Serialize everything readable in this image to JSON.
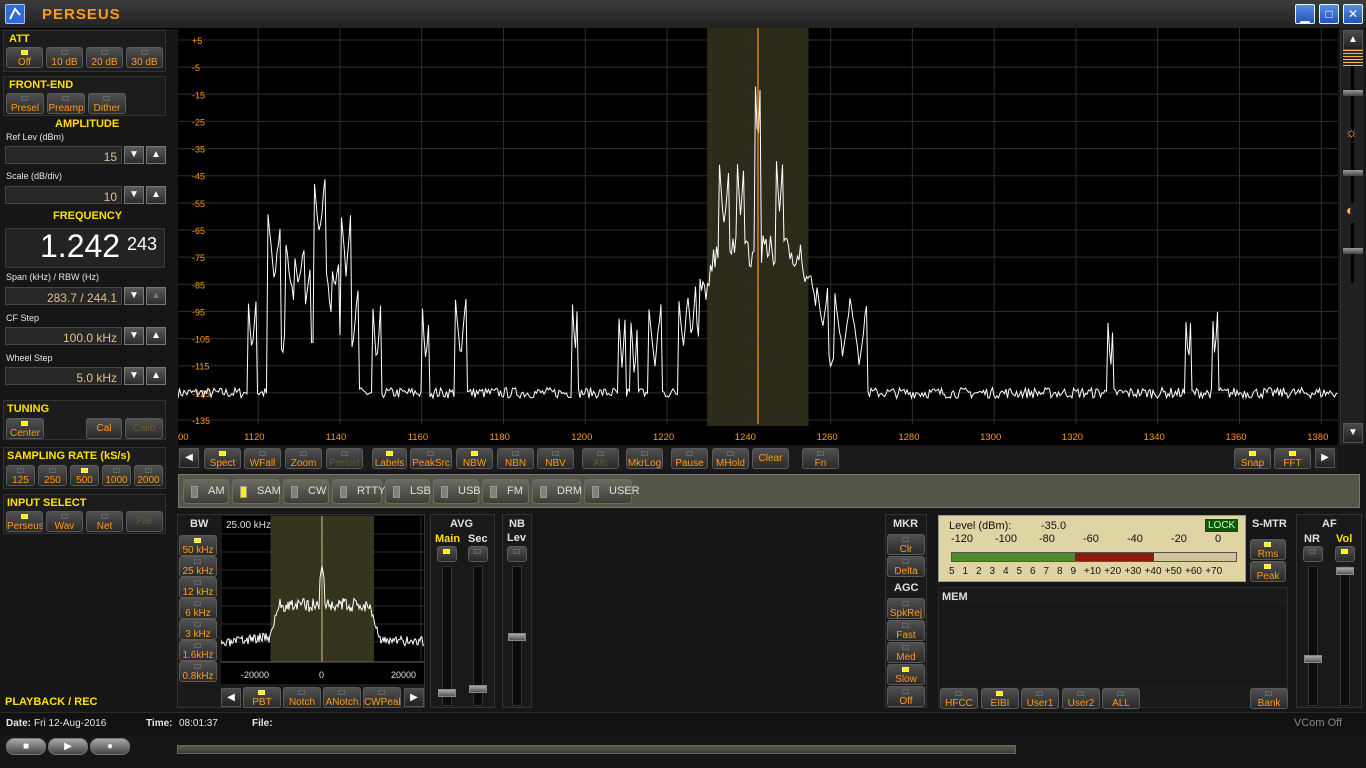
{
  "title": "PERSEUS",
  "colors": {
    "accent": "#ff9a1a",
    "led_on": "#ffee00",
    "trace": "#ffffff",
    "marker": "#ff9a1a"
  },
  "att": {
    "title": "ATT",
    "buttons": [
      "Off",
      "10 dB",
      "20 dB",
      "30 dB"
    ]
  },
  "frontend": {
    "title": "FRONT-END",
    "buttons": [
      "Presel",
      "Preamp",
      "Dither"
    ]
  },
  "amplitude": {
    "title": "AMPLITUDE",
    "ref_label": "Ref Lev (dBm)",
    "ref_value": "15",
    "scale_label": "Scale (dB/div)",
    "scale_value": "10"
  },
  "frequency": {
    "title": "FREQUENCY",
    "main": "1.242",
    "fine": "243",
    "span_label": "Span (kHz) / RBW (Hz)",
    "span_value": "283.7 / 244.1",
    "cfstep_label": "CF Step",
    "cfstep_value": "100.0 kHz",
    "wheel_label": "Wheel Step",
    "wheel_value": "5.0 kHz"
  },
  "tuning": {
    "title": "TUNING",
    "center": "Center",
    "cal": "Cal",
    "calib": "Calib"
  },
  "sampling": {
    "title": "SAMPLING RATE (kS/s)",
    "buttons": [
      "125",
      "250",
      "500",
      "1000",
      "2000"
    ]
  },
  "input": {
    "title": "INPUT SELECT",
    "buttons": [
      "Perseus",
      "Wav",
      "Net",
      "File"
    ]
  },
  "playback": {
    "title": "PLAYBACK / REC"
  },
  "status": {
    "date_label": "Date:",
    "date": "Fri 12-Aug-2016",
    "time_label": "Time:",
    "time": "08:01:37",
    "file_label": "File:",
    "vcom": "VCom Off"
  },
  "spectrum": {
    "y_ticks": [
      "+5",
      "-5",
      "-15",
      "-25",
      "-35",
      "-45",
      "-55",
      "-65",
      "-75",
      "-85",
      "-95",
      "-105",
      "-115",
      "-125",
      "-135"
    ],
    "x_ticks": [
      "00",
      "1120",
      "1140",
      "1160",
      "1180",
      "1200",
      "1220",
      "1240",
      "1260",
      "1280",
      "1300",
      "1320",
      "1340",
      "1360",
      "1380"
    ],
    "x_range_khz": [
      1100.4,
      1384.1
    ],
    "y_range_dbm": [
      -135,
      15
    ],
    "center_khz": 1242.243,
    "passband_khz": [
      1229.8,
      1254.6
    ],
    "noise_floor_dbm": -125
  },
  "toolbar": {
    "buttons": [
      "Spect",
      "WFall",
      "Zoom",
      "Persist",
      "Labels",
      "PeakSrc",
      "NBW",
      "NBN",
      "NBV",
      "Afc",
      "MkrLog",
      "Pause",
      "MHold",
      "Clear",
      "Fn",
      "Snap",
      "FFT"
    ]
  },
  "modes": [
    "AM",
    "SAM",
    "CW",
    "RTTY",
    "LSB",
    "USB",
    "FM",
    "DRM",
    "USER"
  ],
  "bw": {
    "title": "BW",
    "buttons": [
      "50 kHz",
      "25 kHz",
      "12 kHz",
      "6 kHz",
      "3 kHz",
      "1.6kHz",
      "0.8kHz"
    ],
    "value": "25.00 kHz",
    "x_ticks": [
      "-20000",
      "0",
      "20000"
    ],
    "bottom_buttons": [
      "PBT",
      "Notch",
      "ANotch",
      "CWPeak"
    ]
  },
  "avg": {
    "title": "AVG",
    "main": "Main",
    "sec": "Sec"
  },
  "nb": {
    "title": "NB",
    "lev": "Lev"
  },
  "mkr": {
    "title": "MKR",
    "buttons": [
      "Clr",
      "Delta"
    ]
  },
  "agc": {
    "title": "AGC",
    "buttons": [
      "SpkRej",
      "Fast",
      "Med",
      "Slow",
      "Off"
    ]
  },
  "level": {
    "label": "Level (dBm):",
    "value": "-35.0",
    "lock": "LOCK",
    "dbm_scale": [
      "-120",
      "-100",
      "-80",
      "-60",
      "-40",
      "-20",
      "0"
    ],
    "s_scale": [
      "5",
      "1",
      "2",
      "3",
      "4",
      "5",
      "6",
      "7",
      "8",
      "9",
      "+10",
      "+20",
      "+30",
      "+40",
      "+50",
      "+60",
      "+70"
    ],
    "fill_dbm": -35
  },
  "smtr": {
    "title": "S-MTR",
    "buttons": [
      "Rms",
      "Peak"
    ]
  },
  "mem": {
    "title": "MEM",
    "buttons": [
      "HFCC",
      "EIBI",
      "User1",
      "User2",
      "ALL",
      "Bank"
    ]
  },
  "af": {
    "title": "AF",
    "nr": "NR",
    "vol": "Vol"
  }
}
